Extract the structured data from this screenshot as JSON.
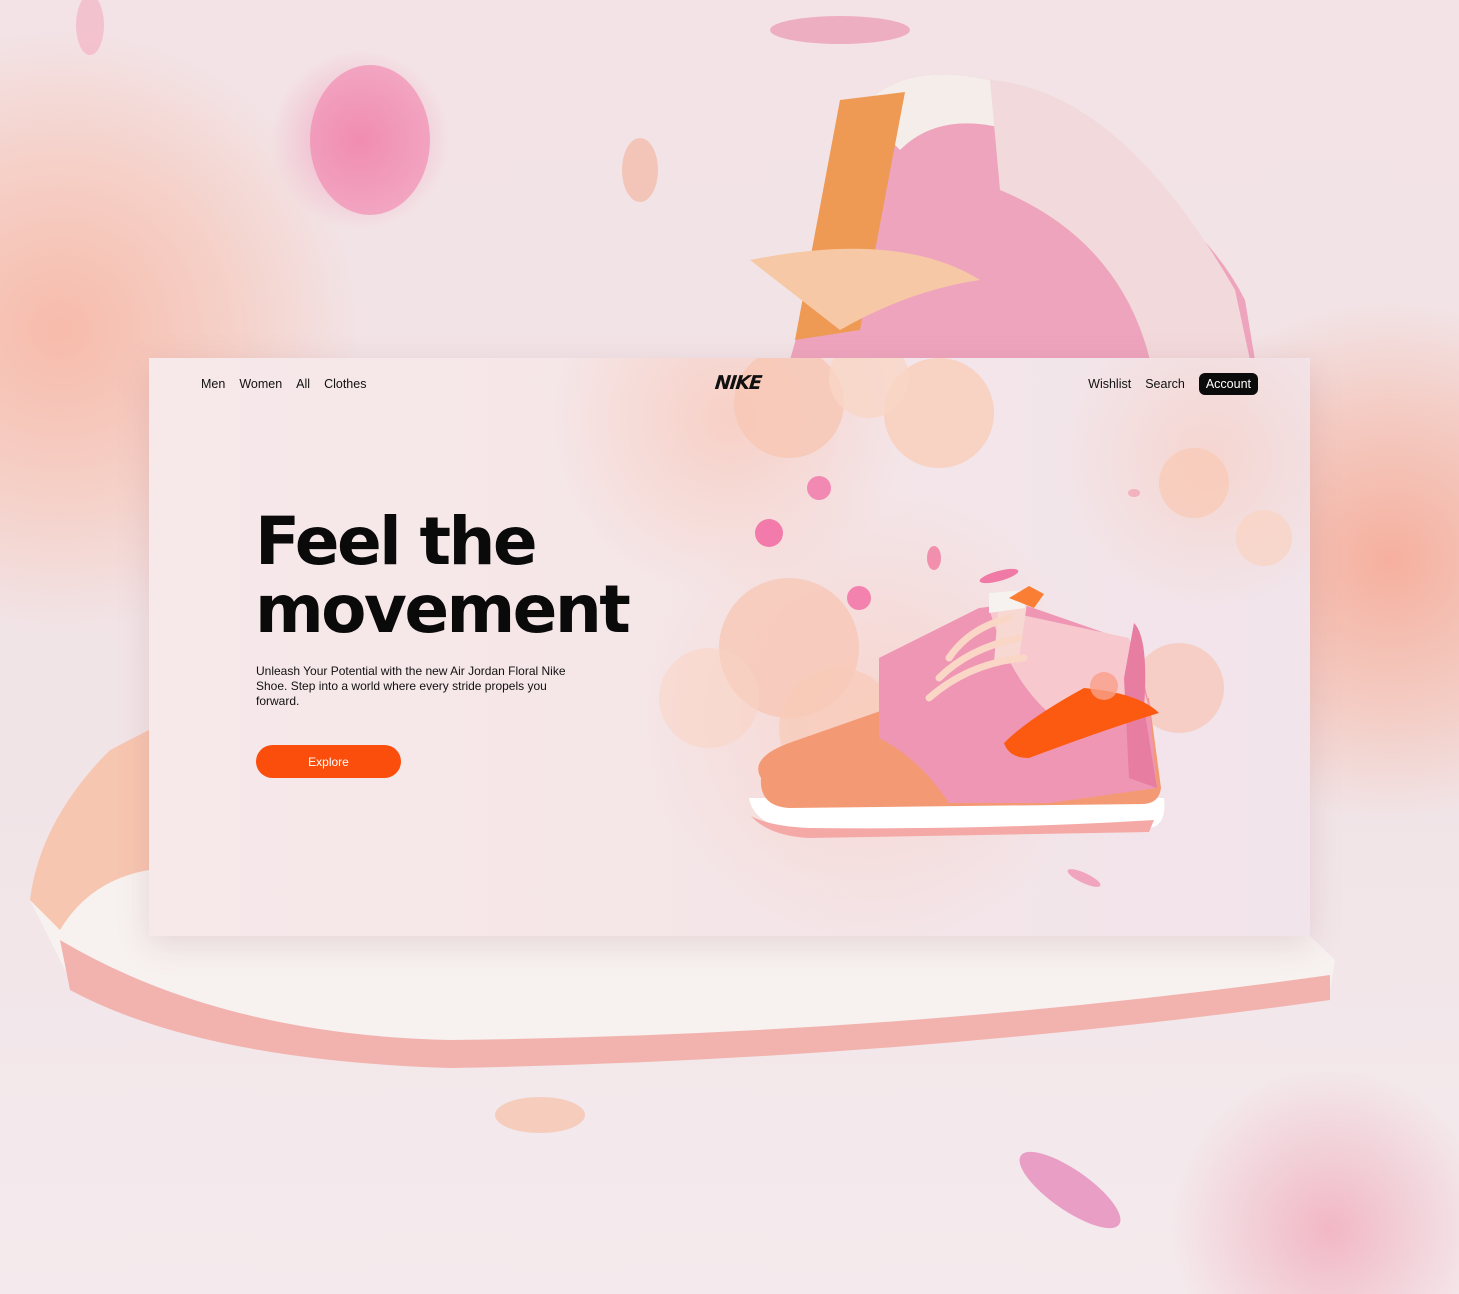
{
  "nav": {
    "left_links": [
      {
        "label": "Men"
      },
      {
        "label": "Women"
      },
      {
        "label": "All"
      },
      {
        "label": "Clothes"
      }
    ],
    "logo_text": "NIKE",
    "right_links": [
      {
        "label": "Wishlist"
      },
      {
        "label": "Search"
      }
    ],
    "account_label": "Account"
  },
  "hero": {
    "title_line1": "Feel the",
    "title_line2": "movement",
    "description": "Unleash Your Potential with the new Air Jordan Floral Nike Shoe. Step into a world where every stride propels you forward.",
    "cta_label": "Explore"
  },
  "colors": {
    "accent": "#fb4d0c",
    "account_bg": "#0b0b0b",
    "text": "#0a0a0a"
  }
}
